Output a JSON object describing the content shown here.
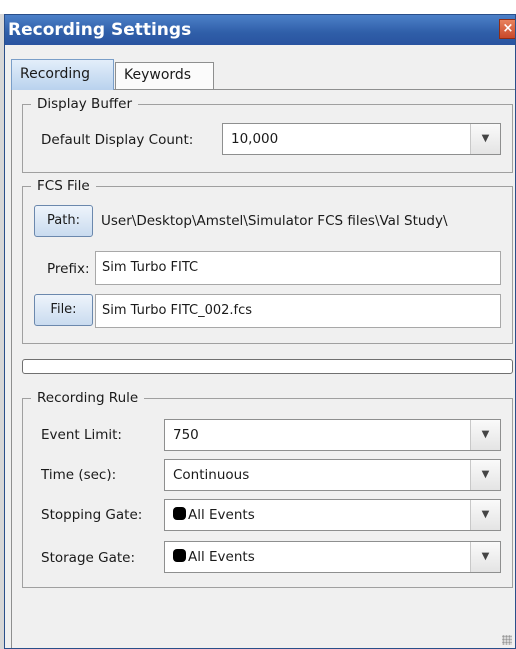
{
  "window": {
    "title": "Recording Settings",
    "close_glyph": "×"
  },
  "tabs": [
    {
      "label": "Recording",
      "active": true
    },
    {
      "label": "Keywords",
      "active": false
    }
  ],
  "display_buffer": {
    "legend": "Display Buffer",
    "count_label": "Default Display Count:",
    "count_value": "10,000"
  },
  "fcs_file": {
    "legend": "FCS File",
    "path_button": "Path:",
    "path_value": "User\\Desktop\\Amstel\\Simulator FCS files\\Val Study\\",
    "prefix_label": "Prefix:",
    "prefix_value": "Sim Turbo FITC",
    "file_button": "File:",
    "file_value": "Sim Turbo FITC_002.fcs"
  },
  "progress": {
    "value": 0
  },
  "recording_rule": {
    "legend": "Recording Rule",
    "event_limit_label": "Event Limit:",
    "event_limit_value": "750",
    "time_label": "Time (sec):",
    "time_value": "Continuous",
    "stopping_gate_label": "Stopping Gate:",
    "stopping_gate_value": "All Events",
    "storage_gate_label": "Storage Gate:",
    "storage_gate_value": "All Events"
  },
  "icons": {
    "dropdown": "chevron-down-icon",
    "gate_color": "#000000"
  }
}
